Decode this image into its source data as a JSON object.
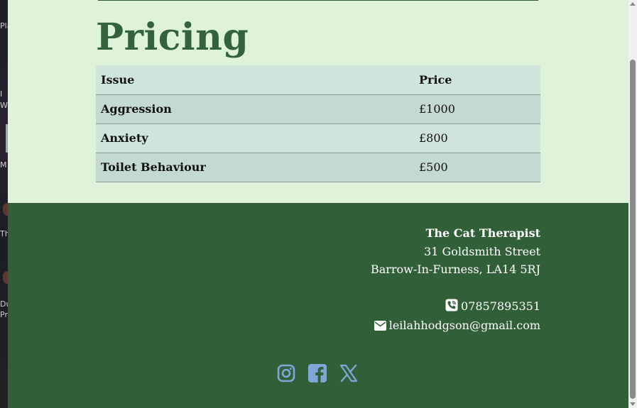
{
  "desktop": {
    "fragments": [
      "Pla",
      "I",
      "W",
      "M",
      "Th",
      "Du",
      "Pr"
    ]
  },
  "pricing": {
    "heading": "Pricing",
    "columns": [
      "Issue",
      "Price"
    ],
    "rows": [
      {
        "issue": "Aggression",
        "price": "£1000"
      },
      {
        "issue": "Anxiety",
        "price": "£800"
      },
      {
        "issue": "Toilet Behaviour",
        "price": "£500"
      }
    ]
  },
  "footer": {
    "business_name": "The Cat Therapist",
    "address_line1": "31 Goldsmith Street",
    "address_line2": "Barrow-In-Furness, LA14 5RJ",
    "phone": "07857895351",
    "email": "leilahhodgson@gmail.com",
    "social_icons": [
      "instagram-icon",
      "facebook-icon",
      "x-twitter-icon"
    ]
  },
  "colors": {
    "page_bg": "#dff3da",
    "heading": "#33633b",
    "footer_bg": "#305f38",
    "social_icon": "#7fa6d8"
  }
}
